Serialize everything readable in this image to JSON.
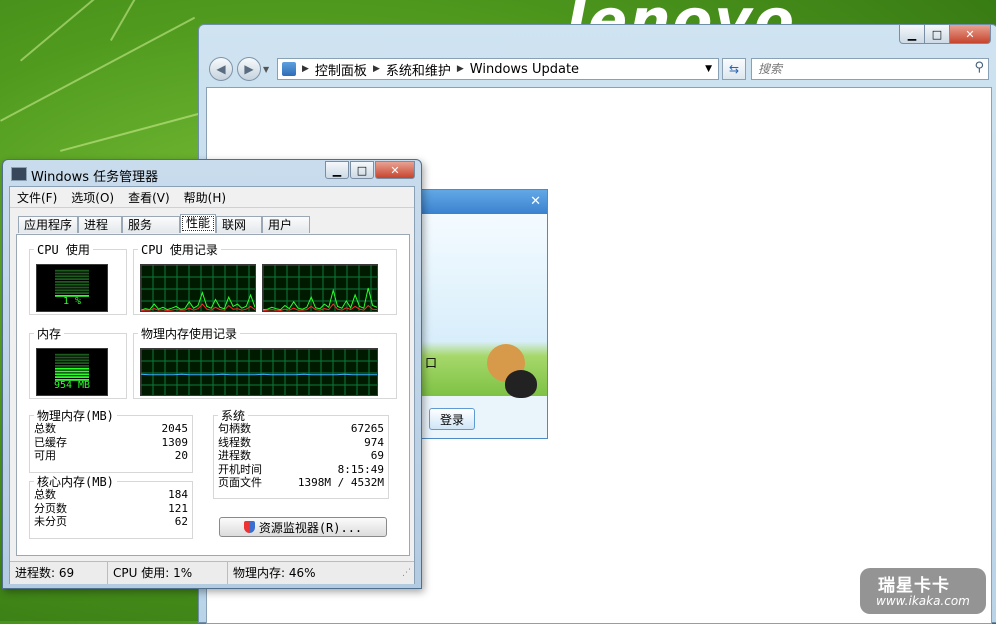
{
  "desktop": {
    "brand": "lenovo"
  },
  "explorer": {
    "breadcrumb": [
      "控制面板",
      "系统和维护",
      "Windows Update"
    ],
    "search_placeholder": "搜索"
  },
  "qq": {
    "partial_char": "口",
    "login_label": "登录"
  },
  "taskmgr": {
    "title": "Windows 任务管理器",
    "menu": [
      "文件(F)",
      "选项(O)",
      "查看(V)",
      "帮助(H)"
    ],
    "tabs": [
      "应用程序",
      "进程",
      "服务",
      "性能",
      "联网",
      "用户"
    ],
    "active_tab": "性能",
    "cpu_usage_label": "CPU 使用",
    "cpu_usage_value": "1 %",
    "cpu_history_label": "CPU 使用记录",
    "mem_label": "内存",
    "mem_value": "954 MB",
    "mem_history_label": "物理内存使用记录",
    "physical_memory": {
      "title": "物理内存(MB)",
      "rows": [
        {
          "label": "总数",
          "value": "2045"
        },
        {
          "label": "已缓存",
          "value": "1309"
        },
        {
          "label": "可用",
          "value": "20"
        }
      ]
    },
    "kernel_memory": {
      "title": "核心内存(MB)",
      "rows": [
        {
          "label": "总数",
          "value": "184"
        },
        {
          "label": "分页数",
          "value": "121"
        },
        {
          "label": "未分页",
          "value": "62"
        }
      ]
    },
    "system": {
      "title": "系统",
      "rows": [
        {
          "label": "句柄数",
          "value": "67265"
        },
        {
          "label": "线程数",
          "value": "974"
        },
        {
          "label": "进程数",
          "value": "69"
        },
        {
          "label": "开机时间",
          "value": "8:15:49"
        },
        {
          "label": "页面文件",
          "value": "1398M / 4532M"
        }
      ]
    },
    "resource_monitor_label": "资源监视器(R)...",
    "status": {
      "processes": "进程数: 69",
      "cpu": "CPU 使用: 1%",
      "memory": "物理内存: 46%"
    },
    "cpu_level": 0.01,
    "mem_level": 0.46
  },
  "watermark": {
    "line1": "瑞星卡卡",
    "line2": "www.ikaka.com"
  }
}
